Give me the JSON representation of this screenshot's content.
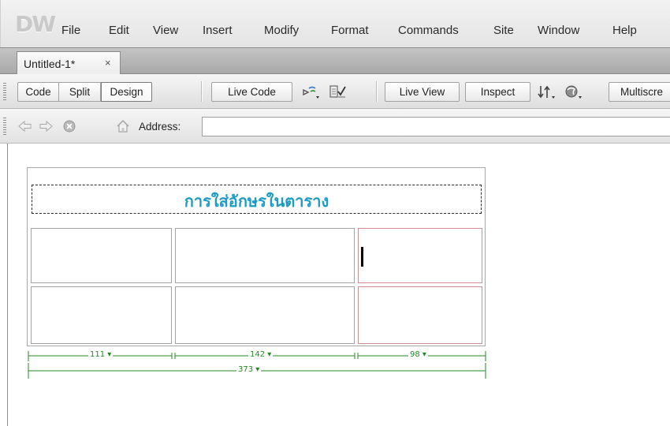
{
  "app": {
    "logo": "DW"
  },
  "menu": {
    "items": [
      "File",
      "Edit",
      "View",
      "Insert",
      "Modify",
      "Format",
      "Commands",
      "Site",
      "Window",
      "Help"
    ]
  },
  "document_tab": {
    "title": "Untitled-1*",
    "close_glyph": "×"
  },
  "doc_toolbar": {
    "view_buttons": [
      "Code",
      "Split",
      "Design"
    ],
    "active_view": "Design",
    "live_code_label": "Live Code",
    "live_view_label": "Live View",
    "inspect_label": "Inspect",
    "multiscreen_label": "Multiscre",
    "icons": [
      "file-management-icon",
      "check-page-icon",
      "preview-debug-icon",
      "visual-aids-icon"
    ]
  },
  "nav_toolbar": {
    "icons": [
      "back-arrow-icon",
      "forward-arrow-icon",
      "stop-icon",
      "home-icon"
    ],
    "address_label": "Address:",
    "address_value": ""
  },
  "table": {
    "caption": "การใส่อักษรในตาราง",
    "column_widths": [
      "111",
      "142",
      "98"
    ],
    "total_width": "373",
    "width_dropdown_glyph": "▾"
  },
  "colors": {
    "heading_text": "#1c9cc4",
    "guide_line": "#238a23",
    "selected_cell_border": "#d08e8e"
  }
}
